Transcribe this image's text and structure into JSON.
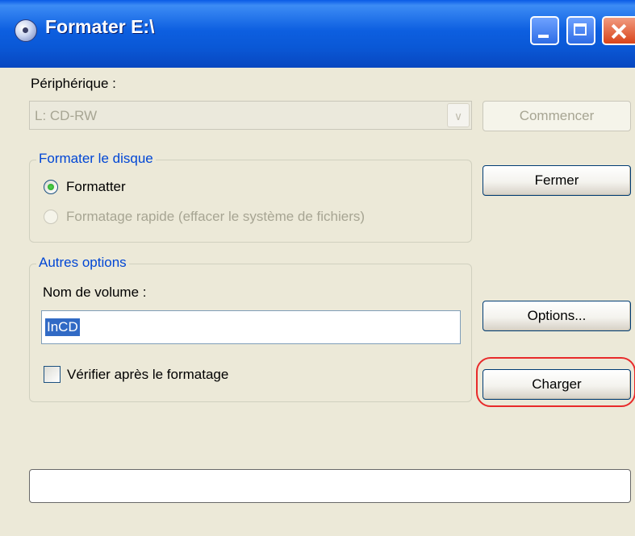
{
  "window": {
    "title": "Formater E:\\"
  },
  "device": {
    "label": "Périphérique :",
    "selected": "L: CD-RW"
  },
  "buttons": {
    "commencer": "Commencer",
    "fermer": "Fermer",
    "options": "Options...",
    "charger": "Charger"
  },
  "format_group": {
    "title": "Formater le disque",
    "option_full": "Formatter",
    "option_quick": "Formatage rapide (effacer le système de fichiers)"
  },
  "options_group": {
    "title": "Autres options",
    "volume_label": "Nom de volume :",
    "volume_value": "InCD",
    "verify_label": "Vérifier après le formatage"
  },
  "progress": {
    "value": 0
  },
  "colors": {
    "titlebar": "#0a58d6",
    "group_title": "#0046d5",
    "highlight": "#e82a2a",
    "selection": "#316ac5"
  }
}
